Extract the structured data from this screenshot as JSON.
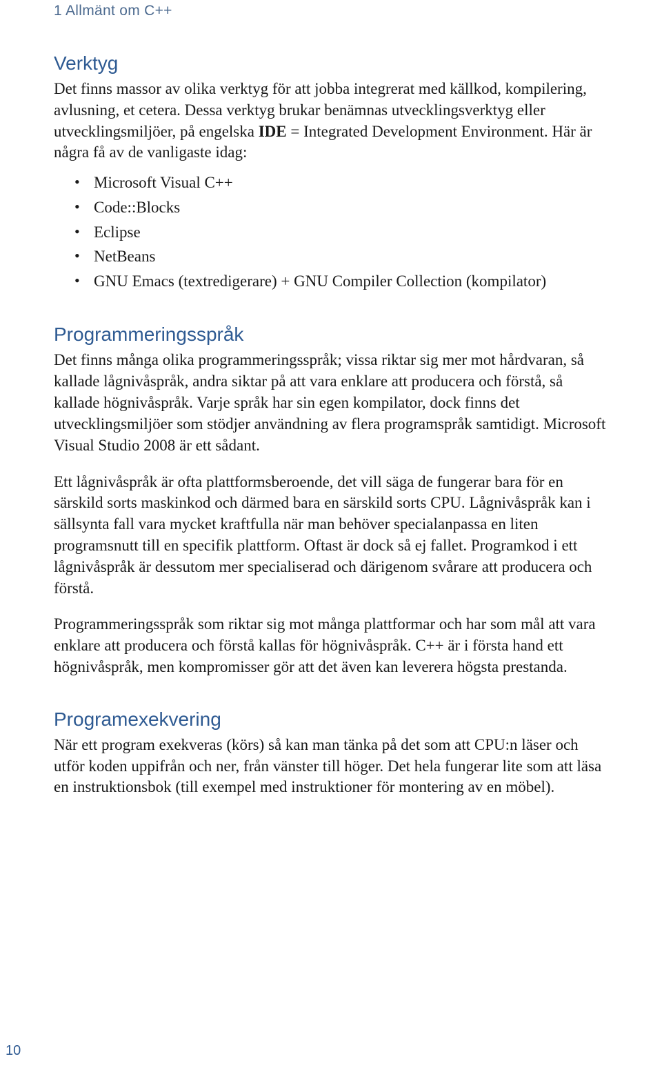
{
  "header": {
    "chapter_label": "1 Allmänt om C++"
  },
  "sections": {
    "verktyg": {
      "title": "Verktyg",
      "para1a": "Det finns massor av olika verktyg för att jobba integrerat med källkod, kompile­ring, avlusning, et cetera. Dessa verktyg brukar benämnas utvecklingsverktyg eller utvecklingsmiljöer, på engelska ",
      "para1_bold": "IDE",
      "para1b": " = Integrated Development Environment. Här är några få av de vanligaste idag:",
      "bullets": [
        "Microsoft Visual C++",
        "Code::Blocks",
        "Eclipse",
        "NetBeans",
        "GNU Emacs (textredigerare) + GNU Compiler Collection (kompilator)"
      ]
    },
    "prog_sprak": {
      "title": "Programmeringsspråk",
      "para1": "Det finns många olika programmeringsspråk; vissa riktar sig mer mot hårdva­ran, så kallade lågnivåspråk, andra siktar på att vara enklare att producera och förstå, så kallade högnivåspråk. Varje språk har sin egen kompilator, dock finns det utvecklingsmiljöer som stödjer användning av flera programspråk samtidigt. Microsoft Visual Studio 2008 är ett sådant.",
      "para2": "Ett lågnivåspråk är ofta plattformsberoende, det vill säga de fungerar bara för en särskild sorts maskinkod och därmed bara en särskild sorts CPU. Lågnivåspråk kan i sällsynta fall vara mycket kraftfulla när man behöver specialanpassa en liten programsnutt till en specifik plattform. Oftast är dock så ej fallet. Programkod i ett lågnivåspråk är dessutom mer specialiserad och därigenom svårare att produ­cera och förstå.",
      "para3": "Programmeringsspråk som riktar sig mot många plattformar och har som mål att vara enklare att producera och förstå kallas för högnivåspråk. C++ är i första hand ett högnivåspråk, men kompromisser gör att det även kan leverera högsta prestanda."
    },
    "prog_exek": {
      "title": "Programexekvering",
      "para1": "När ett program exekveras (körs) så kan man tänka på det som att CPU:n läser och utför koden uppifrån och ner, från vänster till höger. Det hela fungerar lite som att läsa en instruktionsbok (till exempel med instruktioner för montering av en möbel)."
    }
  },
  "page_number": "10"
}
